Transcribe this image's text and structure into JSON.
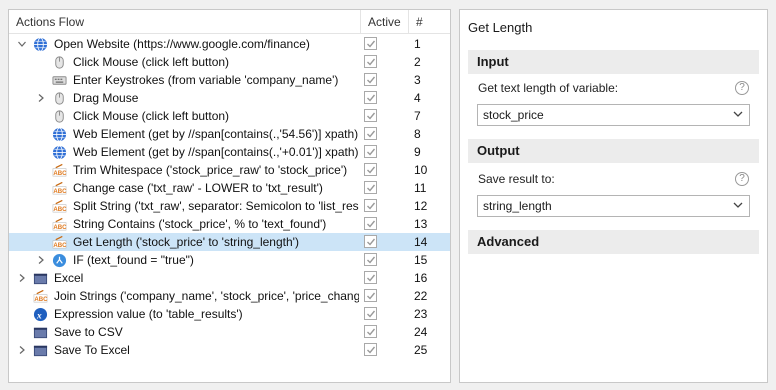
{
  "flow": {
    "headers": {
      "actions": "Actions Flow",
      "active": "Active",
      "num": "#"
    },
    "rows": [
      {
        "label": "Open Website (https://www.google.com/finance)",
        "num": "1",
        "level": 0,
        "expander": "expanded",
        "icon": "globe-icon"
      },
      {
        "label": "Click Mouse (click left button)",
        "num": "2",
        "level": 1,
        "expander": "none",
        "icon": "mouse-icon"
      },
      {
        "label": "Enter Keystrokes (from variable 'company_name')",
        "num": "3",
        "level": 1,
        "expander": "none",
        "icon": "keyboard-icon"
      },
      {
        "label": "Drag Mouse",
        "num": "4",
        "level": 1,
        "expander": "collapsed",
        "icon": "mouse-icon"
      },
      {
        "label": "Click Mouse (click left button)",
        "num": "7",
        "level": 1,
        "expander": "none",
        "icon": "mouse-icon"
      },
      {
        "label": "Web Element (get by //span[contains(.,'54.56')] xpath)",
        "num": "8",
        "level": 1,
        "expander": "none",
        "icon": "globe-icon"
      },
      {
        "label": "Web Element (get by //span[contains(.,'+0.01')] xpath)",
        "num": "9",
        "level": 1,
        "expander": "none",
        "icon": "globe-icon"
      },
      {
        "label": "Trim Whitespace ('stock_price_raw' to 'stock_price')",
        "num": "10",
        "level": 1,
        "expander": "none",
        "icon": "abc-text-icon"
      },
      {
        "label": "Change case ('txt_raw' - LOWER to 'txt_result')",
        "num": "11",
        "level": 1,
        "expander": "none",
        "icon": "abc-text-icon"
      },
      {
        "label": "Split String ('txt_raw', separator: Semicolon to 'list_result')",
        "num": "12",
        "level": 1,
        "expander": "none",
        "icon": "abc-text-icon"
      },
      {
        "label": "String Contains ('stock_price', % to 'text_found')",
        "num": "13",
        "level": 1,
        "expander": "none",
        "icon": "abc-text-icon"
      },
      {
        "label": "Get Length ('stock_price' to 'string_length')",
        "num": "14",
        "level": 1,
        "expander": "none",
        "icon": "abc-text-icon",
        "selected": true
      },
      {
        "label": "IF (text_found = \"true\")",
        "num": "15",
        "level": 1,
        "expander": "collapsed",
        "icon": "if-branch-icon"
      },
      {
        "label": "Excel",
        "num": "16",
        "level": 0,
        "expander": "collapsed",
        "icon": "window-icon"
      },
      {
        "label": "Join Strings ('company_name', 'stock_price', 'price_change')",
        "num": "22",
        "level": 0,
        "expander": "none",
        "icon": "abc-text-icon"
      },
      {
        "label": "Expression value (to 'table_results')",
        "num": "23",
        "level": 0,
        "expander": "none",
        "icon": "expression-icon"
      },
      {
        "label": "Save to CSV",
        "num": "24",
        "level": 0,
        "expander": "none",
        "icon": "window-icon"
      },
      {
        "label": "Save To Excel",
        "num": "25",
        "level": 0,
        "expander": "collapsed",
        "icon": "window-icon"
      }
    ]
  },
  "props": {
    "title": "Get Length",
    "input": {
      "heading": "Input",
      "label": "Get text length of variable:",
      "value": "stock_price"
    },
    "output": {
      "heading": "Output",
      "label": "Save result to:",
      "value": "string_length"
    },
    "advanced": {
      "heading": "Advanced"
    },
    "help_glyph": "?"
  },
  "colors": {
    "selected_row": "#cce4f7",
    "section_bg": "#ececec",
    "globe": "#2f6fd6",
    "abc_orange": "#e07a1f"
  }
}
